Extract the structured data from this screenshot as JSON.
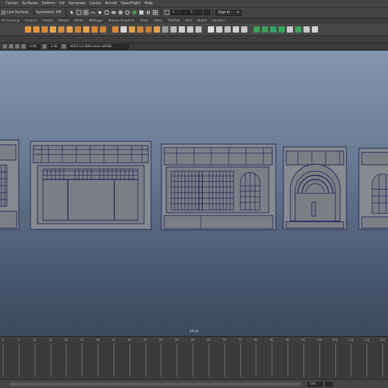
{
  "app": {
    "menu": [
      "Curves",
      "Surfaces",
      "Deform",
      "UV",
      "Generate",
      "Cache",
      "Arnold",
      "OpenFlight",
      "Help"
    ]
  },
  "statusline": {
    "workspace": "Live Surface",
    "symmetry": "Symmetry: Off",
    "field_1": "1",
    "field_2": "2",
    "signin": "Sign In"
  },
  "shelf_tabs": [
    "FX Caching",
    "Custom",
    "Arnold",
    "Bifrost",
    "MASH",
    "MtPlugin",
    "Motion Graphics",
    "XGen",
    "VRay",
    "TURTLE",
    "Hmt",
    "Bullet",
    "Houdini"
  ],
  "viewport_bar": {
    "value_a": "0.00",
    "value_b": "1.00",
    "color_space": "ACES 1.0 SDR-video (sRGB)"
  },
  "viewport": {
    "camera": "persp",
    "colors": {
      "sky_top": "#8396ad",
      "sky_bottom": "#3c4960",
      "wire": "#1a1d52",
      "geo": "#858a90"
    }
  },
  "timeline": {
    "frame_numbers": [
      "1",
      "5",
      "10",
      "15",
      "20",
      "25",
      "30",
      "35",
      "40",
      "45",
      "50",
      "55",
      "60",
      "65",
      "70",
      "75",
      "80",
      "85",
      "90",
      "95",
      "100",
      "105",
      "110",
      "115",
      "120"
    ],
    "range_end": "120"
  }
}
